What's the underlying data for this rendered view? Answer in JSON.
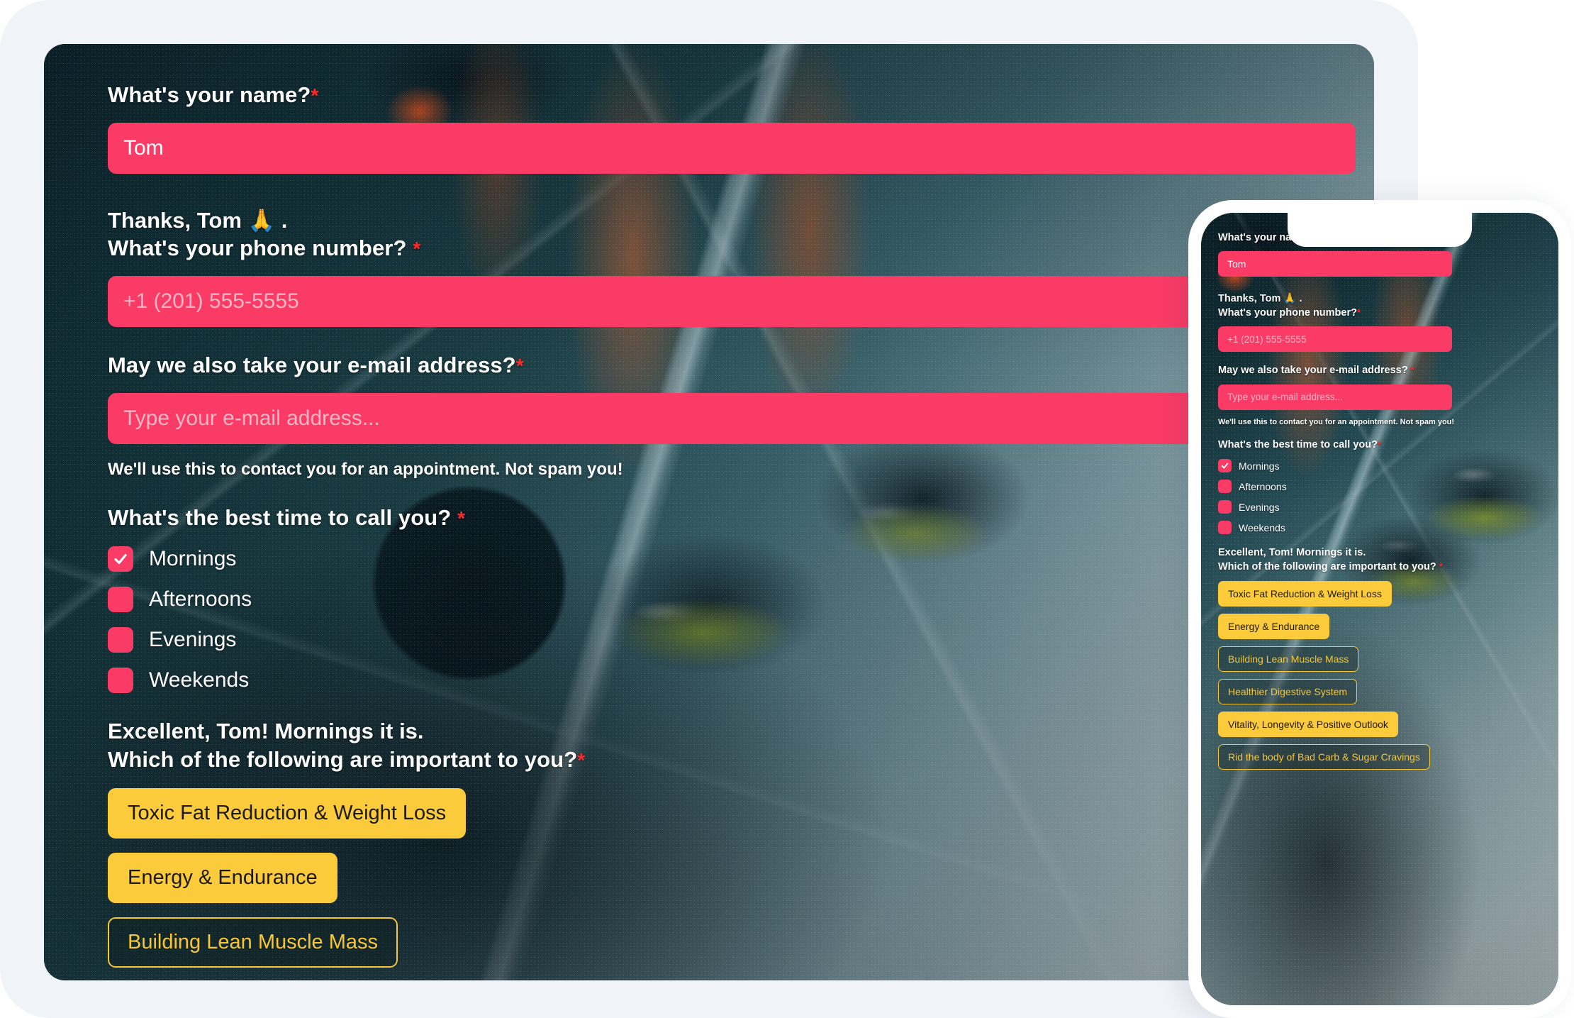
{
  "colors": {
    "accent_pink": "#F93B66",
    "accent_yellow": "#FBCB3B",
    "required_red": "#FF2A2A",
    "page_bg": "#F0F3F8",
    "text_white": "#FFFFFF"
  },
  "desktop": {
    "name_question": "What's your name?",
    "name_value": "Tom",
    "thanks_line": "Thanks, Tom 🙏 .",
    "phone_question": "What's your phone number?",
    "phone_placeholder": "+1 (201) 555-5555",
    "email_question": "May we also take your e-mail address?",
    "email_placeholder": "Type your e-mail address...",
    "email_helper": "We'll use this to contact you for an appointment. Not spam you!",
    "time_question": "What's the best time to call you?",
    "time_options": [
      {
        "label": "Mornings",
        "checked": true
      },
      {
        "label": "Afternoons",
        "checked": false
      },
      {
        "label": "Evenings",
        "checked": false
      },
      {
        "label": "Weekends",
        "checked": false
      }
    ],
    "excellent_line": "Excellent, Tom! Mornings it is.",
    "goals_question": "Which of the following are important to you?",
    "goals": [
      {
        "label": "Toxic Fat Reduction & Weight Loss",
        "selected": true
      },
      {
        "label": "Energy & Endurance",
        "selected": true
      },
      {
        "label": "Building Lean Muscle Mass",
        "selected": false
      }
    ],
    "required_marker": "*"
  },
  "phone": {
    "name_question": "What's your name?",
    "name_value": "Tom",
    "thanks_line": "Thanks, Tom 🙏 .",
    "phone_question": "What's your phone number?",
    "phone_placeholder": "+1 (201) 555-5555",
    "email_question": "May we also take your e-mail address?",
    "email_placeholder": "Type your e-mail address...",
    "email_helper": "We'll use this to contact you for an appointment. Not spam you!",
    "time_question": "What's the best time to call you?",
    "time_options": [
      {
        "label": "Mornings",
        "checked": true
      },
      {
        "label": "Afternoons",
        "checked": false
      },
      {
        "label": "Evenings",
        "checked": false
      },
      {
        "label": "Weekends",
        "checked": false
      }
    ],
    "excellent_line": "Excellent, Tom! Mornings it is.",
    "goals_question": "Which of the following are important to you?",
    "goals": [
      {
        "label": "Toxic Fat Reduction & Weight Loss",
        "selected": true
      },
      {
        "label": "Energy & Endurance",
        "selected": true
      },
      {
        "label": "Building Lean Muscle Mass",
        "selected": false
      },
      {
        "label": "Healthier Digestive System",
        "selected": false
      },
      {
        "label": "Vitality, Longevity & Positive Outlook",
        "selected": true
      },
      {
        "label": "Rid the body of Bad Carb & Sugar Cravings",
        "selected": false
      }
    ],
    "required_marker": "*"
  }
}
